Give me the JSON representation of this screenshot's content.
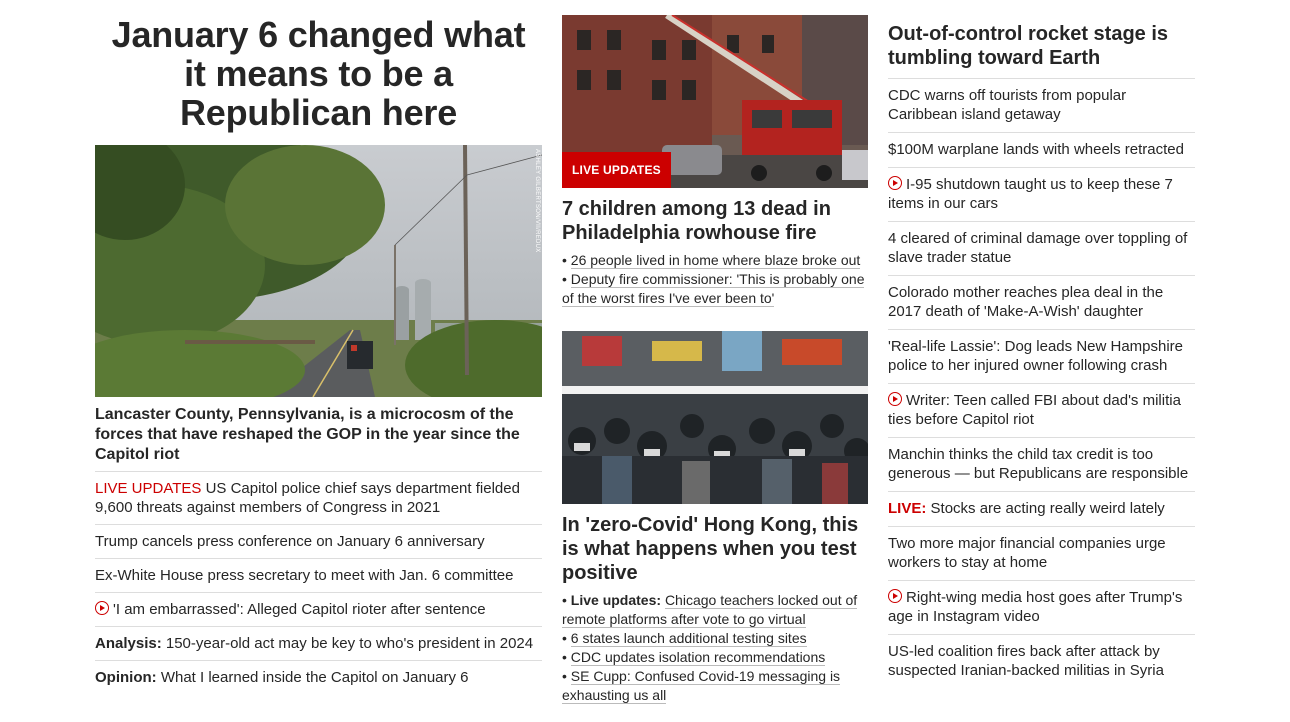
{
  "left": {
    "hero_title": "January 6 changed what it means to be a Republican here",
    "image_credit": "ASHLEY GILBERTSON/VII/REDUX",
    "sub_headline": "Lancaster County, Pennsylvania, is a microcosm of the forces that have reshaped the GOP in the year since the Capitol riot",
    "stories": [
      {
        "prefix": "LIVE UPDATES",
        "text": "US Capitol police chief says department fielded 9,600 threats against members of Congress in 2021"
      },
      {
        "text": "Trump cancels press conference on January 6 anniversary"
      },
      {
        "text": "Ex-White House press secretary to meet with Jan. 6 committee"
      },
      {
        "video": true,
        "text": "'I am embarrassed': Alleged Capitol rioter after sentence"
      },
      {
        "prefix": "Analysis:",
        "text": "150-year-old act may be key to who's president in 2024"
      },
      {
        "prefix": "Opinion:",
        "text": "What I learned inside the Capitol on January 6"
      }
    ]
  },
  "middle": {
    "fire": {
      "badge": "LIVE UPDATES",
      "headline": "7 children among 13 dead in Philadelphia rowhouse fire",
      "bullets": [
        "26 people lived in home where blaze broke out",
        "Deputy fire commissioner: 'This is probably one of the worst fires I've ever been to'"
      ]
    },
    "covid": {
      "headline": "In 'zero-Covid' Hong Kong, this is what happens when you test positive",
      "bullets": [
        {
          "prefix": "Live updates:",
          "text": "Chicago teachers locked out of remote platforms after vote to go virtual"
        },
        {
          "text": "6 states launch additional testing sites"
        },
        {
          "text": "CDC updates isolation recommendations"
        },
        {
          "text": "SE Cupp: Confused Covid-19 messaging is exhausting us all"
        }
      ]
    }
  },
  "right": {
    "headline": "Out-of-control rocket stage is tumbling toward Earth",
    "stories": [
      {
        "text": "CDC warns off tourists from popular Caribbean island getaway"
      },
      {
        "text": "$100M warplane lands with wheels retracted"
      },
      {
        "video": true,
        "text": "I-95 shutdown taught us to keep these 7 items in our cars"
      },
      {
        "text": "4 cleared of criminal damage over toppling of slave trader statue"
      },
      {
        "text": "Colorado mother reaches plea deal in the 2017 death of 'Make-A-Wish' daughter"
      },
      {
        "text": "'Real-life Lassie': Dog leads New Hampshire police to her injured owner following crash"
      },
      {
        "video": true,
        "text": "Writer: Teen called FBI about dad's militia ties before Capitol riot"
      },
      {
        "text": "Manchin thinks the child tax credit is too generous — but Republicans are responsible"
      },
      {
        "prefix": "LIVE:",
        "text": "Stocks are acting really weird lately"
      },
      {
        "text": "Two more major financial companies urge workers to stay at home"
      },
      {
        "video": true,
        "text": "Right-wing media host goes after Trump's age in Instagram video"
      },
      {
        "text": "US-led coalition fires back after attack by suspected Iranian-backed militias in Syria"
      }
    ]
  },
  "colors": {
    "accent": "#cc0000",
    "text": "#262626",
    "divider": "#dddddd"
  }
}
